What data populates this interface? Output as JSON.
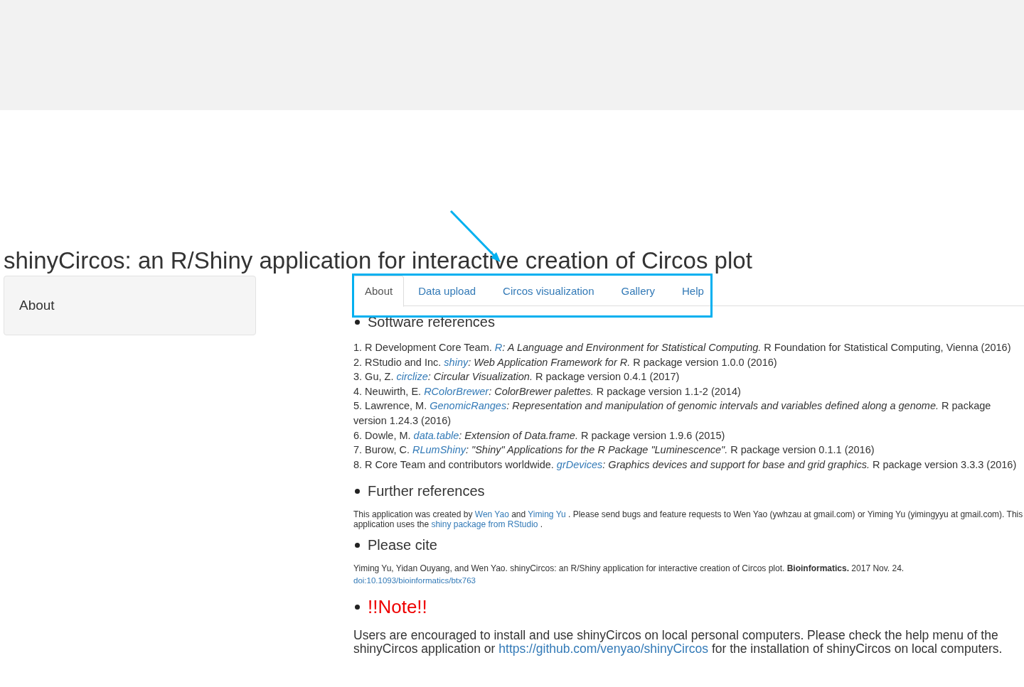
{
  "title": "shinyCircos: an R/Shiny application for interactive creation of Circos plot",
  "sidebar": {
    "label": "About"
  },
  "tabs": [
    {
      "label": "About",
      "selected": true
    },
    {
      "label": "Data upload",
      "selected": false
    },
    {
      "label": "Circos visualization",
      "selected": false
    },
    {
      "label": "Gallery",
      "selected": false
    },
    {
      "label": "Help",
      "selected": false
    }
  ],
  "software_references": {
    "heading": "Software references",
    "items": [
      {
        "number": "1.",
        "author": "R Development Core Team.",
        "link": "R",
        "title": ": A Language and Environment for Statistical Computing.",
        "rest": "R Foundation for Statistical Computing, Vienna (2016)"
      },
      {
        "number": "2.",
        "author": "RStudio and Inc.",
        "link": "shiny",
        "title": ": Web Application Framework for R.",
        "rest": "R package version 1.0.0 (2016)"
      },
      {
        "number": "3.",
        "author": "Gu, Z.",
        "link": "circlize",
        "title": ": Circular Visualization.",
        "rest": "R package version 0.4.1 (2017)"
      },
      {
        "number": "4.",
        "author": "Neuwirth, E.",
        "link": "RColorBrewer",
        "title": ": ColorBrewer palettes.",
        "rest": "R package version 1.1-2 (2014)"
      },
      {
        "number": "5.",
        "author": "Lawrence, M.",
        "link": "GenomicRanges",
        "title": ": Representation and manipulation of genomic intervals and variables defined along a genome.",
        "rest": "R package version 1.24.3 (2016)"
      },
      {
        "number": "6.",
        "author": "Dowle, M.",
        "link": "data.table",
        "title": ": Extension of Data.frame.",
        "rest": "R package version 1.9.6 (2015)"
      },
      {
        "number": "7.",
        "author": "Burow, C.",
        "link": "RLumShiny",
        "title": ": \"Shiny\" Applications for the R Package \"Luminescence\".",
        "rest": "R package version 0.1.1 (2016)"
      },
      {
        "number": "8.",
        "author": "R Core Team and contributors worldwide.",
        "link": "grDevices",
        "title": ": Graphics devices and support for base and grid graphics.",
        "rest": "R package version 3.3.3 (2016)"
      }
    ]
  },
  "further_references": {
    "heading": "Further references",
    "parts": [
      {
        "kind": "text",
        "text": "This application was created by"
      },
      {
        "kind": "link",
        "text": "Wen Yao"
      },
      {
        "kind": "text",
        "text": "and"
      },
      {
        "kind": "link",
        "text": "Yiming Yu"
      },
      {
        "kind": "text",
        "text": ". Please send bugs and feature requests to Wen Yao (ywhzau at gmail.com) or Yiming Yu (yimingyyu at gmail.com). This application uses the"
      },
      {
        "kind": "link",
        "text": "shiny package from RStudio"
      },
      {
        "kind": "text",
        "text": "."
      }
    ]
  },
  "cite": {
    "heading": "Please cite",
    "text": "Yiming Yu, Yidan Ouyang, and Wen Yao. shinyCircos: an R/Shiny application for interactive creation of Circos plot. **Bioinformatics.** 2017 Nov. 24.",
    "doi": "doi:10.1093/bioinformatics/btx763"
  },
  "note": {
    "heading": "!!Note!!",
    "parts": [
      {
        "kind": "text",
        "text": "Users are encouraged to install and use shinyCircos on local personal computers. Please check the help menu of the shinyCircos application or"
      },
      {
        "kind": "link",
        "text": "https://github.com/venyao/shinyCircos"
      },
      {
        "kind": "text",
        "text": "for the installation of shinyCircos on local computers."
      }
    ]
  }
}
